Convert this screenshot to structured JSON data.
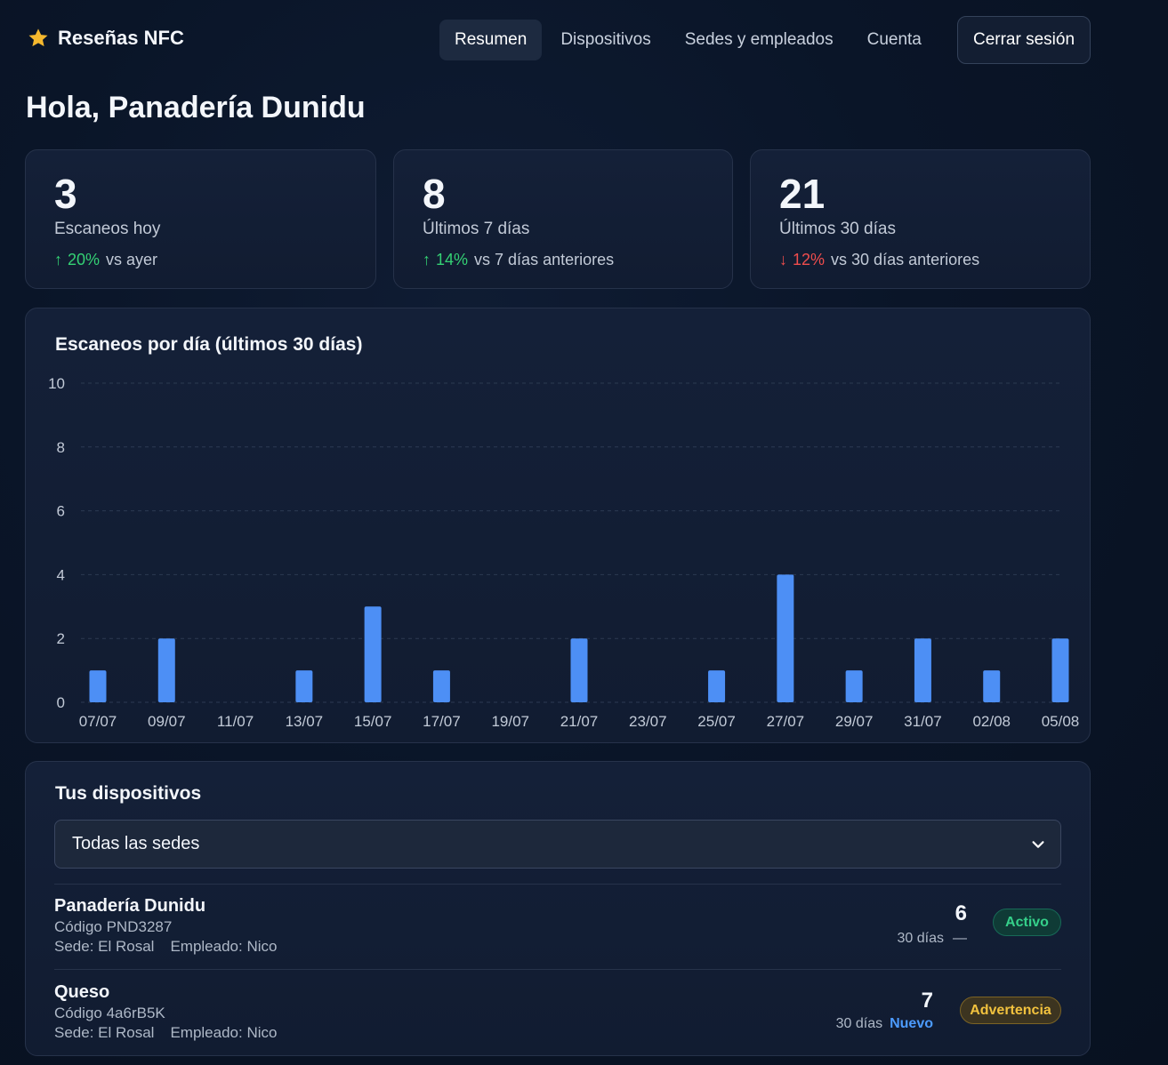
{
  "app": {
    "title": "Reseñas NFC",
    "brand_icon": "star-icon",
    "brand_color": "#f5b82e"
  },
  "nav": {
    "items": [
      {
        "label": "Resumen",
        "active": true
      },
      {
        "label": "Dispositivos",
        "active": false
      },
      {
        "label": "Sedes y empleados",
        "active": false
      },
      {
        "label": "Cuenta",
        "active": false
      }
    ],
    "logout_label": "Cerrar sesión"
  },
  "greeting": "Hola, Panadería Dunidu",
  "stats": [
    {
      "value": "3",
      "label": "Escaneos hoy",
      "trend": "up",
      "pct": "20%",
      "compare": "vs ayer"
    },
    {
      "value": "8",
      "label": "Últimos 7 días",
      "trend": "up",
      "pct": "14%",
      "compare": "vs 7 días anteriores"
    },
    {
      "value": "21",
      "label": "Últimos 30 días",
      "trend": "down",
      "pct": "12%",
      "compare": "vs 30 días anteriores"
    }
  ],
  "colors": {
    "bar": "#4d8ff5",
    "up": "#34d174",
    "down": "#f04d4d",
    "grid": "#2c3a52"
  },
  "chart_title": "Escaneos por día (últimos 30 días)",
  "chart_data": {
    "type": "bar",
    "title": "Escaneos por día (últimos 30 días)",
    "xlabel": "",
    "ylabel": "",
    "ylim": [
      0,
      10
    ],
    "yticks": [
      0,
      2,
      4,
      6,
      8,
      10
    ],
    "grid": true,
    "categories": [
      "07/07",
      "09/07",
      "11/07",
      "13/07",
      "15/07",
      "17/07",
      "19/07",
      "21/07",
      "23/07",
      "25/07",
      "27/07",
      "29/07",
      "31/07",
      "02/08",
      "05/08"
    ],
    "values": [
      1,
      2,
      0,
      1,
      3,
      1,
      0,
      2,
      0,
      1,
      4,
      1,
      2,
      1,
      2
    ]
  },
  "devices": {
    "title": "Tus dispositivos",
    "filter_value": "Todas las sedes",
    "items": [
      {
        "name": "Panadería Dunidu",
        "code": "Código PND3287",
        "sede": "Sede: El Rosal",
        "empleado": "Empleado: Nico",
        "count": "6",
        "period": "30 días",
        "delta": "—",
        "status": "Activo",
        "status_type": "ok"
      },
      {
        "name": "Queso",
        "code": "Código 4a6rB5K",
        "sede": "Sede: El Rosal",
        "empleado": "Empleado: Nico",
        "count": "7",
        "period": "30 días",
        "delta": "Nuevo",
        "status": "Advertencia",
        "status_type": "warn"
      }
    ]
  }
}
